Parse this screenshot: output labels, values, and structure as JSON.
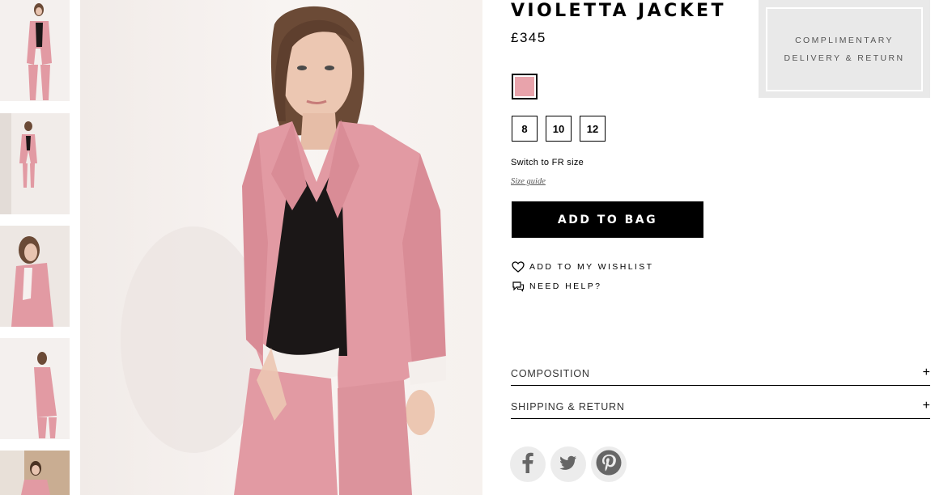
{
  "product": {
    "title": "VIOLETTA JACKET",
    "price": "£345",
    "colour_swatch": "#e8a3ab",
    "sizes": [
      "8",
      "10",
      "12"
    ],
    "switch_size": "Switch to FR size",
    "size_guide": "Size guide",
    "add_to_bag": "ADD TO BAG"
  },
  "links": {
    "wishlist": "ADD TO MY WISHLIST",
    "need_help": "NEED HELP?"
  },
  "accordions": {
    "composition": "COMPOSITION",
    "shipping": "SHIPPING & RETURN",
    "expand_symbol": "+"
  },
  "promo": {
    "line1": "COMPLIMENTARY",
    "line2": "DELIVERY & RETURN"
  },
  "social": [
    "facebook-icon",
    "twitter-icon",
    "pinterest-icon"
  ],
  "colors": {
    "jacket_pink": "#e29aa3",
    "top_black": "#1b1717",
    "hair": "#6b4a36"
  }
}
